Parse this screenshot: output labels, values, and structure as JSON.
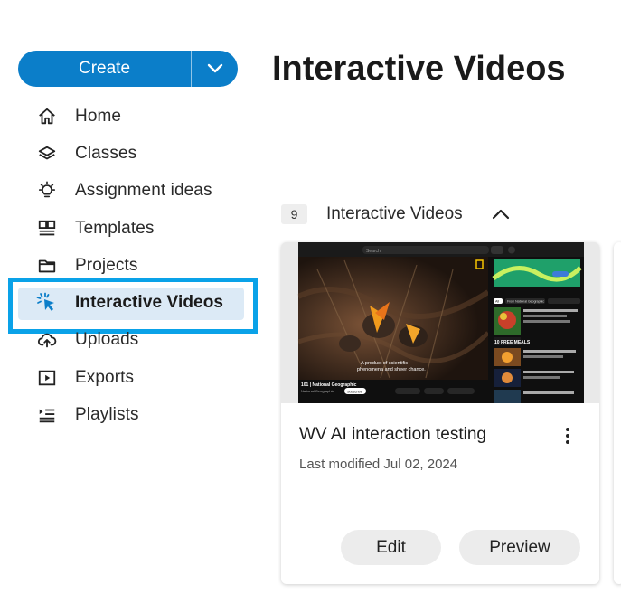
{
  "create": {
    "label": "Create"
  },
  "nav": {
    "items": [
      {
        "label": "Home",
        "icon": "home-icon"
      },
      {
        "label": "Classes",
        "icon": "layers-icon"
      },
      {
        "label": "Assignment ideas",
        "icon": "lightbulb-icon"
      },
      {
        "label": "Templates",
        "icon": "templates-icon"
      },
      {
        "label": "Projects",
        "icon": "folder-icon"
      },
      {
        "label": "Interactive Videos",
        "icon": "cursor-click-icon",
        "active": true
      },
      {
        "label": "Uploads",
        "icon": "cloud-upload-icon"
      },
      {
        "label": "Exports",
        "icon": "play-box-icon"
      },
      {
        "label": "Playlists",
        "icon": "playlist-icon"
      }
    ]
  },
  "page": {
    "title": "Interactive Videos"
  },
  "section": {
    "count": "9",
    "title": "Interactive Videos"
  },
  "card": {
    "title": "WV AI interaction testing",
    "meta": "Last modified Jul 02, 2024",
    "edit_label": "Edit",
    "preview_label": "Preview"
  },
  "thumbnail": {
    "search_text": "Search",
    "subtitle": "A product of scientific phenomena and sheer chance.",
    "video_title": "101 | National Geographic",
    "channel": "National Geographic",
    "subscribe": "Subscribe",
    "side_label": "10 FREE MEALS",
    "chip_all": "All",
    "chip_natgeo": "From National Geographic"
  },
  "colors": {
    "accent": "#0b7ec9",
    "focus": "#0aa2e8",
    "highlight": "#dceaf6"
  }
}
